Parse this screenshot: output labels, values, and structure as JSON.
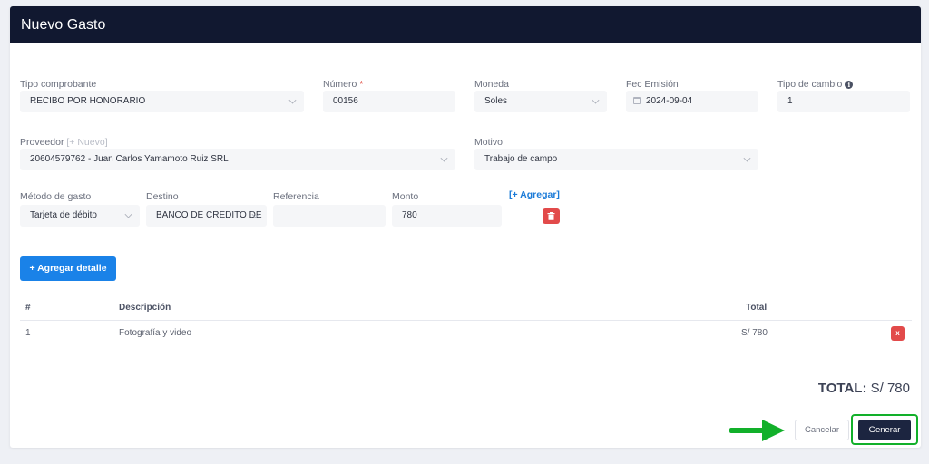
{
  "modal": {
    "title": "Nuevo Gasto"
  },
  "form": {
    "tipo_comprobante": {
      "label": "Tipo comprobante",
      "value": "RECIBO POR HONORARIO"
    },
    "numero": {
      "label": "Número",
      "required_mark": "*",
      "value": "00156"
    },
    "moneda": {
      "label": "Moneda",
      "value": "Soles"
    },
    "fec_emision": {
      "label": "Fec Emisión",
      "value": "2024-09-04"
    },
    "tipo_cambio": {
      "label": "Tipo de cambio",
      "info_icon": "i",
      "value": "1"
    },
    "proveedor": {
      "label": "Proveedor",
      "new_link": "[+ Nuevo]",
      "value": "20604579762 - Juan Carlos Yamamoto Ruiz SRL"
    },
    "motivo": {
      "label": "Motivo",
      "value": "Trabajo de campo"
    }
  },
  "payment": {
    "metodo": {
      "label": "Método de gasto",
      "value": "Tarjeta de débito"
    },
    "destino": {
      "label": "Destino",
      "value": "BANCO DE CREDITO DE"
    },
    "referencia": {
      "label": "Referencia",
      "value": ""
    },
    "monto": {
      "label": "Monto",
      "value": "780"
    },
    "add_link": "[+ Agregar]"
  },
  "detail": {
    "add_button": "+ Agregar detalle",
    "columns": {
      "num": "#",
      "description": "Descripción",
      "total": "Total"
    },
    "rows": [
      {
        "num": "1",
        "description": "Fotografía y video",
        "total": "S/ 780",
        "delete": "x"
      }
    ]
  },
  "summary": {
    "total_label": "TOTAL:",
    "total_value": "S/ 780"
  },
  "footer": {
    "cancel_label": "Cancelar",
    "generate_label": "Generar"
  },
  "colors": {
    "header_bg": "#111830",
    "primary": "#1a82e8",
    "danger": "#e24a4a",
    "dark_button": "#1c2540",
    "highlight": "#12b02a"
  }
}
